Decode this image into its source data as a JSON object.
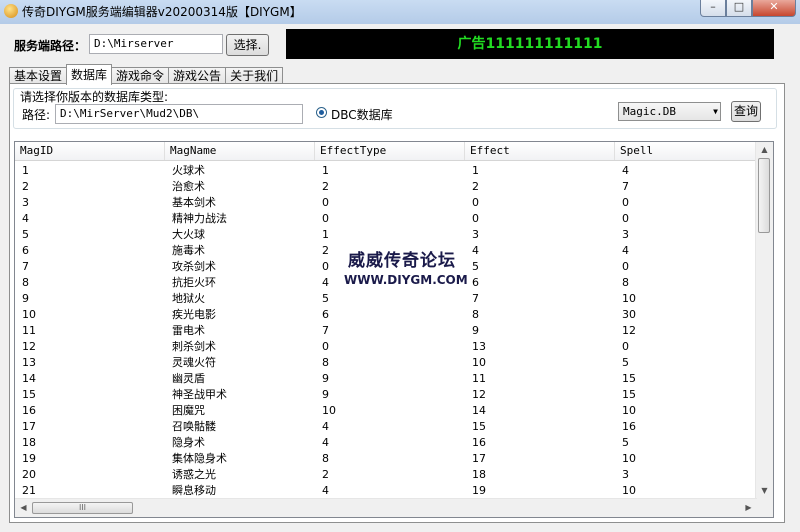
{
  "window": {
    "title": "传奇DIYGM服务端编辑器v20200314版【DIYGM】",
    "minimize": "–",
    "maximize": "□",
    "close": "✕"
  },
  "server": {
    "path_label": "服务端路径：",
    "path_value": "D:\\Mirserver",
    "browse_button": "选择."
  },
  "ad_text": "广告111111111111",
  "tabs": [
    "基本设置",
    "数据库",
    "游戏命令",
    "游戏公告",
    "关于我们"
  ],
  "active_tab": 1,
  "db": {
    "prompt": "请选择你版本的数据库类型:",
    "path_label": "路径:",
    "path_value": "D:\\MirServer\\Mud2\\DB\\",
    "radio_label": "DBC数据库",
    "select_value": "Magic.DB",
    "query_button": "查询"
  },
  "table": {
    "columns": [
      "MagID",
      "MagName",
      "EffectType",
      "Effect",
      "Spell"
    ],
    "rows": [
      [
        "1",
        "火球术",
        "1",
        "1",
        "4"
      ],
      [
        "2",
        "治愈术",
        "2",
        "2",
        "7"
      ],
      [
        "3",
        "基本剑术",
        "0",
        "0",
        "0"
      ],
      [
        "4",
        "精神力战法",
        "0",
        "0",
        "0"
      ],
      [
        "5",
        "大火球",
        "1",
        "3",
        "3"
      ],
      [
        "6",
        "施毒术",
        "2",
        "4",
        "4"
      ],
      [
        "7",
        "攻杀剑术",
        "0",
        "5",
        "0"
      ],
      [
        "8",
        "抗拒火环",
        "4",
        "6",
        "8"
      ],
      [
        "9",
        "地狱火",
        "5",
        "7",
        "10"
      ],
      [
        "10",
        "疾光电影",
        "6",
        "8",
        "30"
      ],
      [
        "11",
        "雷电术",
        "7",
        "9",
        "12"
      ],
      [
        "12",
        "刺杀剑术",
        "0",
        "13",
        "0"
      ],
      [
        "13",
        "灵魂火符",
        "8",
        "10",
        "5"
      ],
      [
        "14",
        "幽灵盾",
        "9",
        "11",
        "15"
      ],
      [
        "15",
        "神圣战甲术",
        "9",
        "12",
        "15"
      ],
      [
        "16",
        "困魔咒",
        "10",
        "14",
        "10"
      ],
      [
        "17",
        "召唤骷髅",
        "4",
        "15",
        "16"
      ],
      [
        "18",
        "隐身术",
        "4",
        "16",
        "5"
      ],
      [
        "19",
        "集体隐身术",
        "8",
        "17",
        "10"
      ],
      [
        "20",
        "诱惑之光",
        "2",
        "18",
        "3"
      ],
      [
        "21",
        "瞬息移动",
        "4",
        "19",
        "10"
      ]
    ]
  },
  "watermark": {
    "title": "威威传奇论坛",
    "url": "WWW.DIYGM.COM"
  },
  "scrollbar": {
    "thumb_grip": "III"
  }
}
